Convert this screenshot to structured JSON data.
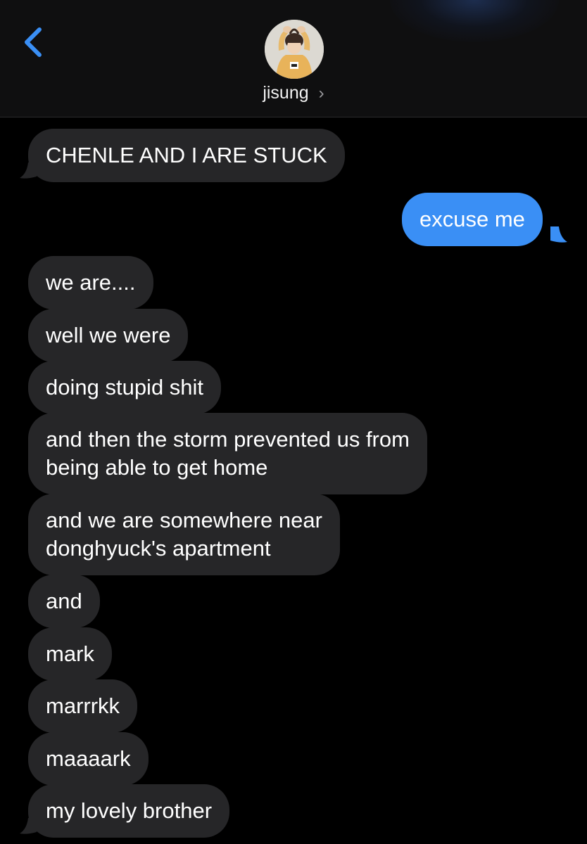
{
  "header": {
    "back_label": "Back",
    "contact_name": "jisung",
    "chevron": "›"
  },
  "colors": {
    "received_bubble": "#262628",
    "sent_bubble": "#3a8ff5",
    "accent": "#3a8ff5",
    "background": "#000000"
  },
  "messages": [
    {
      "type": "received",
      "lines": [
        "CHENLE AND I ARE STUCK"
      ]
    },
    {
      "type": "sent",
      "lines": [
        "excuse me"
      ]
    },
    {
      "type": "received",
      "lines": [
        "we are...."
      ]
    },
    {
      "type": "received",
      "lines": [
        "well we were"
      ]
    },
    {
      "type": "received",
      "lines": [
        "doing stupid shit"
      ]
    },
    {
      "type": "received",
      "lines": [
        "and then the storm prevented us from",
        "being able to get home"
      ]
    },
    {
      "type": "received",
      "lines": [
        "and we are somewhere near",
        "donghyuck's apartment"
      ]
    },
    {
      "type": "received",
      "lines": [
        "and"
      ]
    },
    {
      "type": "received",
      "lines": [
        "mark"
      ]
    },
    {
      "type": "received",
      "lines": [
        "marrrkk"
      ]
    },
    {
      "type": "received",
      "lines": [
        "maaaark"
      ]
    },
    {
      "type": "received",
      "lines": [
        "my lovely brother"
      ]
    }
  ]
}
